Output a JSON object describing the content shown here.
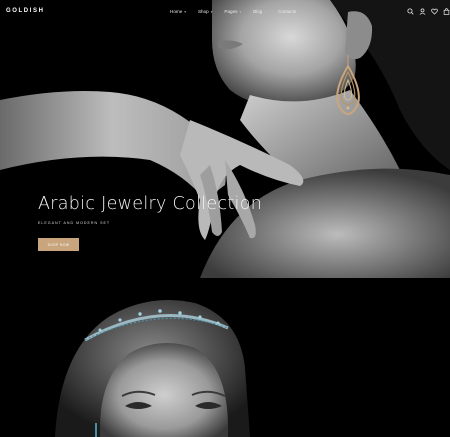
{
  "header": {
    "logo": "GOLDISH",
    "nav": [
      {
        "label": "Home",
        "has_dropdown": true
      },
      {
        "label": "Shop",
        "has_dropdown": true
      },
      {
        "label": "Pages",
        "has_dropdown": true
      },
      {
        "label": "Blog",
        "has_dropdown": true
      },
      {
        "label": "Contacts",
        "has_dropdown": false
      }
    ],
    "icons": [
      "search-icon",
      "user-icon",
      "heart-icon",
      "bag-icon"
    ]
  },
  "hero": {
    "title": "Arabic Jewelry Collection",
    "subtitle": "ELEGANT AND MODERN SET",
    "button_label": "SHOP NOW"
  },
  "colors": {
    "accent": "#c9a57e",
    "background": "#000000",
    "text": "#ffffff"
  }
}
